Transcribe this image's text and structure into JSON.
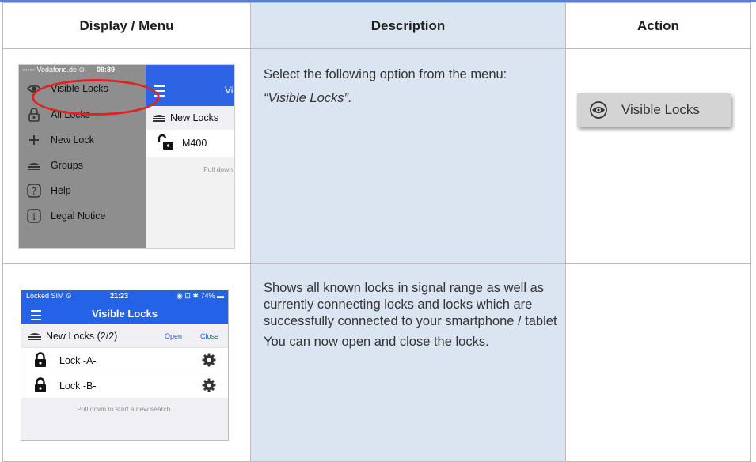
{
  "table": {
    "headers": [
      "Display / Menu",
      "Description",
      "Action"
    ],
    "row1": {
      "description": [
        "Select the following option from the menu:",
        "“Visible Locks”."
      ],
      "action_label": "Visible Locks",
      "screenshot": {
        "status_carrier": "◦◦◦◦◦ Vodafone.de ⊙",
        "status_time": "09:39",
        "menu_items": [
          {
            "icon": "eye-icon",
            "label": "Visible Locks"
          },
          {
            "icon": "lock-icon",
            "label": "All Locks"
          },
          {
            "icon": "plus-icon",
            "label": "New Lock"
          },
          {
            "icon": "groups-icon",
            "label": "Groups"
          },
          {
            "icon": "help-icon",
            "label": "Help"
          },
          {
            "icon": "info-icon",
            "label": "Legal Notice"
          }
        ],
        "pane_title": "Vi",
        "pane_group": "New Locks",
        "pane_lock": "M400",
        "pane_hint": "Pull down",
        "highlight_color": "#e02222"
      }
    },
    "row2": {
      "description": [
        "Shows all known locks in signal range as well as currently connecting locks and locks which are successfully connected to your smartphone / tablet",
        "You can now open and close the locks."
      ],
      "screenshot": {
        "status_carrier": "Locked SIM ⊙",
        "status_time": "21:23",
        "status_battery": "74%",
        "title": "Visible Locks",
        "group": "New Locks (2/2)",
        "open_label": "Open",
        "close_label": "Close",
        "locks": [
          "Lock -A-",
          "Lock -B-"
        ],
        "hint": "Pull down to start a new search.",
        "bar_color": "#2563e6"
      }
    }
  },
  "colors": {
    "desc_bg": "#dbe4f1",
    "accent_line": "#5b84c4"
  }
}
